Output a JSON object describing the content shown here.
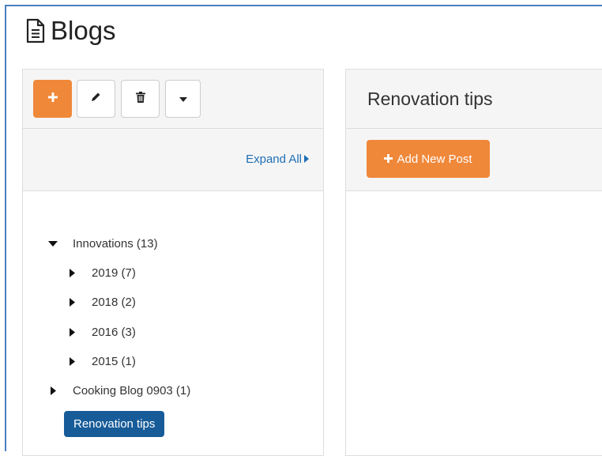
{
  "page": {
    "title": "Blogs"
  },
  "toolbar": {
    "buttons": [
      {
        "name": "add-button",
        "icon": "plus-icon"
      },
      {
        "name": "edit-button",
        "icon": "pencil-icon"
      },
      {
        "name": "delete-button",
        "icon": "trash-icon"
      },
      {
        "name": "more-dropdown-button",
        "icon": "caret-down-icon"
      }
    ]
  },
  "tree_controls": {
    "expand_all_label": "Expand All"
  },
  "tree": {
    "nodes": [
      {
        "label": "Innovations (13)",
        "expanded": true
      },
      {
        "label": "2019 (7)"
      },
      {
        "label": "2018 (2)"
      },
      {
        "label": "2016 (3)"
      },
      {
        "label": "2015 (1)"
      },
      {
        "label": "Cooking Blog 0903 (1)"
      }
    ],
    "selected_label": "Renovation tips"
  },
  "detail": {
    "title": "Renovation tips",
    "add_post_label": "Add New Post"
  },
  "colors": {
    "accent_orange": "#f0883a",
    "selected_blue": "#175c99",
    "link_blue": "#1f6fb5"
  }
}
